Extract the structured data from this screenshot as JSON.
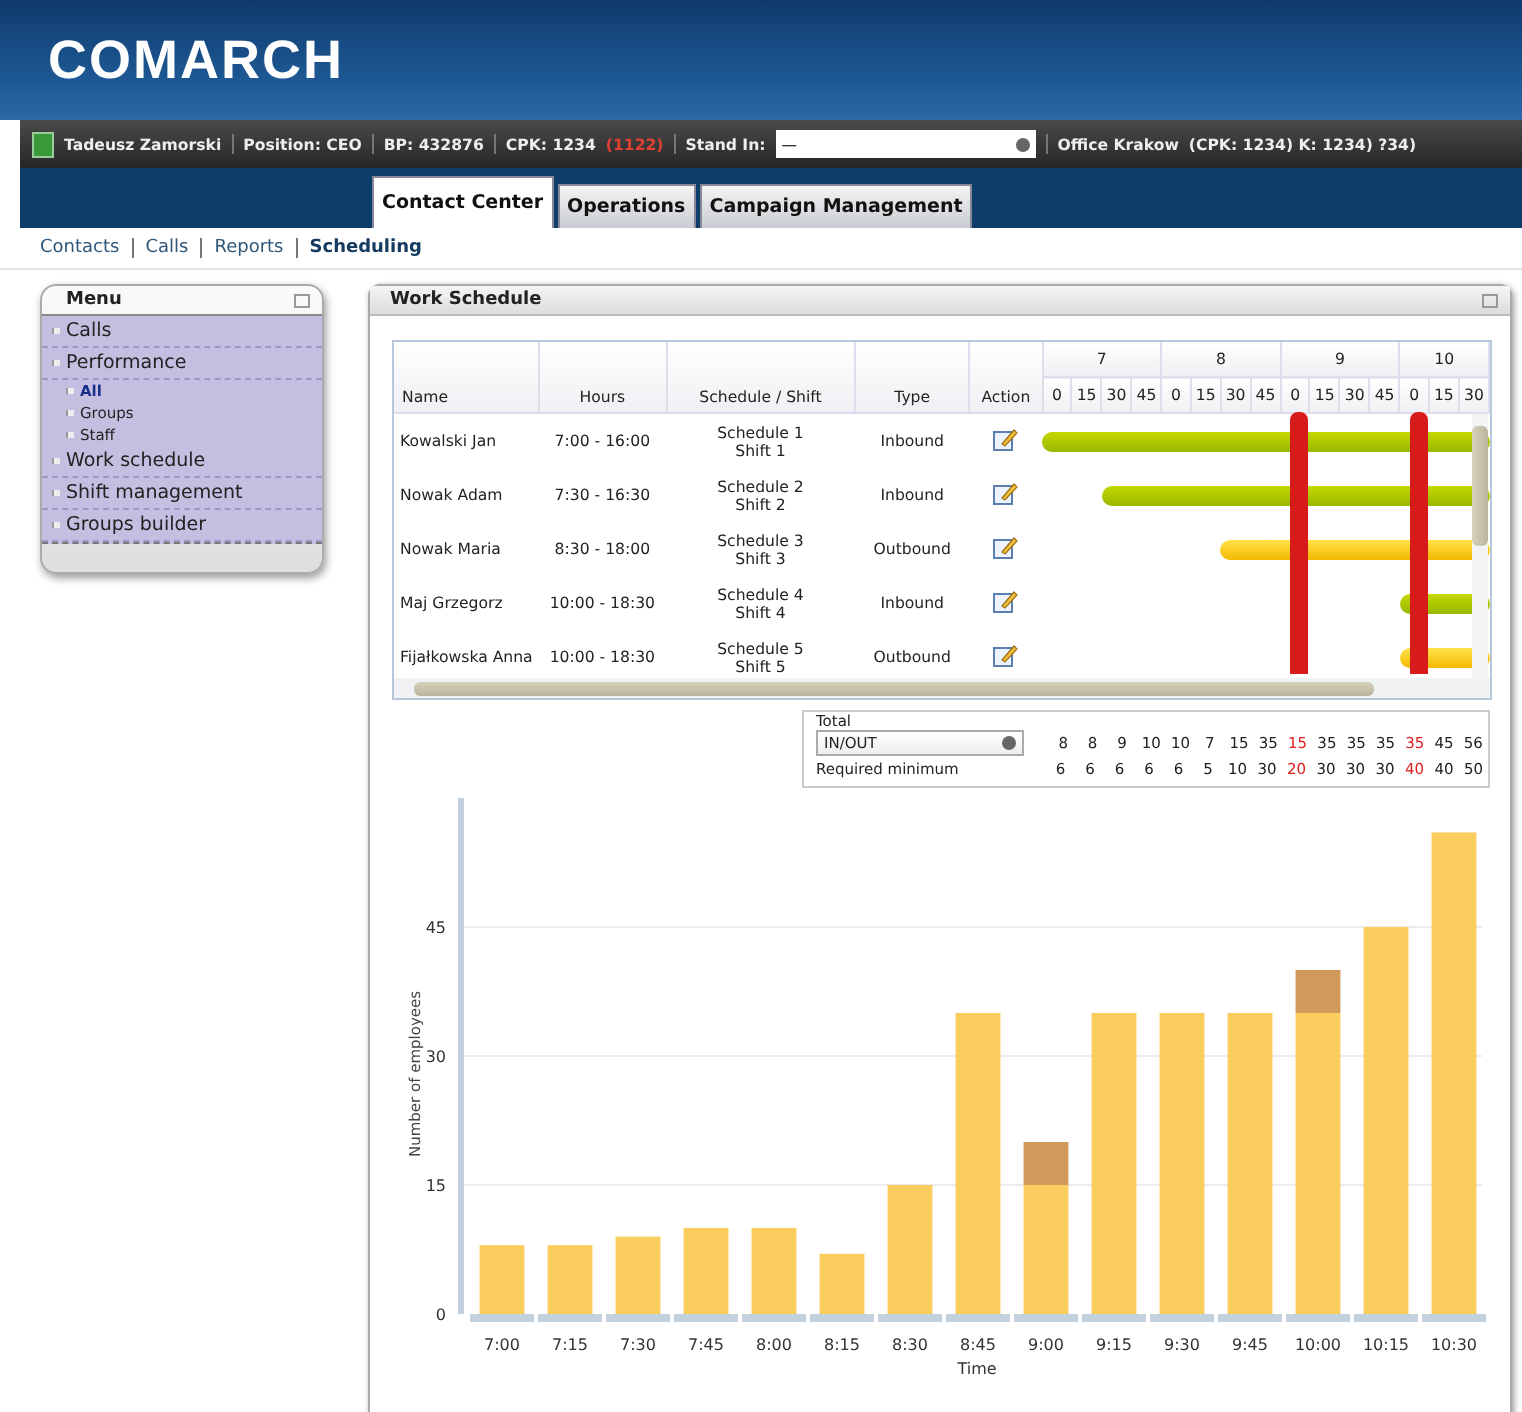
{
  "logo": "COMARCH",
  "user_bar": {
    "user": "Tadeusz Zamorski",
    "position": "Position: CEO",
    "bp": "BP: 432876",
    "cpk": "CPK: 1234",
    "cpk_alert": "(1122)",
    "stand_in_label": "Stand In:",
    "stand_in_value": "—",
    "office": "Office Krakow",
    "office_codes": "(CPK: 1234) K: 1234) ?34)"
  },
  "tabs": [
    {
      "label": "Contact Center",
      "selected": true
    },
    {
      "label": "Operations",
      "selected": false
    },
    {
      "label": "Campaign Management",
      "selected": false
    }
  ],
  "subnav": [
    {
      "label": "Contacts",
      "selected": false
    },
    {
      "label": "Calls",
      "selected": false
    },
    {
      "label": "Reports",
      "selected": false
    },
    {
      "label": "Scheduling",
      "selected": true
    }
  ],
  "menu": {
    "title": "Menu",
    "items": [
      {
        "label": "Calls",
        "selected": false
      },
      {
        "label": "Performance",
        "selected": false,
        "children": [
          {
            "label": "All",
            "selected": true
          },
          {
            "label": "Groups",
            "selected": false
          },
          {
            "label": "Staff",
            "selected": false
          }
        ]
      },
      {
        "label": "Work schedule",
        "selected": false
      },
      {
        "label": "Shift management",
        "selected": false
      },
      {
        "label": "Groups builder",
        "selected": false
      }
    ]
  },
  "panel_title": "Work Schedule",
  "schedule": {
    "columns": [
      "Name",
      "Hours",
      "Schedule / Shift",
      "Type",
      "Action"
    ],
    "hours": [
      {
        "label": "7",
        "alert": false,
        "slots": [
          "0",
          "15",
          "30",
          "45"
        ]
      },
      {
        "label": "8",
        "alert": false,
        "slots": [
          "0",
          "15",
          "30",
          "45"
        ]
      },
      {
        "label": "9",
        "alert": true,
        "slots": [
          "0",
          "15",
          "30",
          "45"
        ]
      },
      {
        "label": "10",
        "alert": true,
        "slots": [
          "0",
          "15",
          "30"
        ]
      }
    ],
    "rows": [
      {
        "name": "Kowalski Jan",
        "hours": "7:00 - 16:00",
        "schedule": "Schedule 1",
        "shift": "Shift 1",
        "type": "Inbound",
        "kind": "inbound",
        "level": 1.0
      },
      {
        "name": "Nowak Adam",
        "hours": "7:30 - 16:30",
        "schedule": "Schedule 2",
        "shift": "Shift 2",
        "type": "Inbound",
        "kind": "inbound",
        "level": 0.867
      },
      {
        "name": "Nowak Maria",
        "hours": "8:30 - 18:00",
        "schedule": "Schedule 3",
        "shift": "Shift 3",
        "type": "Outbound",
        "kind": "outbound",
        "level": 0.6
      },
      {
        "name": "Maj Grzegorz",
        "hours": "10:00 - 18:30",
        "schedule": "Schedule 4",
        "shift": "Shift 4",
        "type": "Inbound",
        "kind": "inbound",
        "level": 0.2
      },
      {
        "name": "Fijałkowska Anna",
        "hours": "10:00 - 18:30",
        "schedule": "Schedule 5",
        "shift": "Shift 5",
        "type": "Outbound",
        "kind": "outbound",
        "level": 0.2
      }
    ]
  },
  "totals": {
    "title": "Total",
    "select": "IN/OUT",
    "total_cells": [
      {
        "value": "8",
        "alert": false
      },
      {
        "value": "8",
        "alert": false
      },
      {
        "value": "9",
        "alert": false
      },
      {
        "value": "10",
        "alert": false
      },
      {
        "value": "10",
        "alert": false
      },
      {
        "value": "7",
        "alert": false
      },
      {
        "value": "15",
        "alert": false
      },
      {
        "value": "35",
        "alert": false
      },
      {
        "value": "15",
        "alert": true
      },
      {
        "value": "35",
        "alert": false
      },
      {
        "value": "35",
        "alert": false
      },
      {
        "value": "35",
        "alert": false
      },
      {
        "value": "35",
        "alert": true
      },
      {
        "value": "45",
        "alert": false
      },
      {
        "value": "56",
        "alert": false
      }
    ],
    "required_label": "Required minimum",
    "required_cells": [
      {
        "value": "6",
        "alert": false
      },
      {
        "value": "6",
        "alert": false
      },
      {
        "value": "6",
        "alert": false
      },
      {
        "value": "6",
        "alert": false
      },
      {
        "value": "6",
        "alert": false
      },
      {
        "value": "5",
        "alert": false
      },
      {
        "value": "10",
        "alert": false
      },
      {
        "value": "30",
        "alert": false
      },
      {
        "value": "20",
        "alert": true
      },
      {
        "value": "30",
        "alert": false
      },
      {
        "value": "30",
        "alert": false
      },
      {
        "value": "30",
        "alert": false
      },
      {
        "value": "40",
        "alert": true
      },
      {
        "value": "40",
        "alert": false
      },
      {
        "value": "50",
        "alert": false
      }
    ]
  },
  "chart_data": {
    "type": "bar",
    "stacked": true,
    "xlabel": "Time",
    "ylabel": "Number of employees",
    "categories": [
      "7:00",
      "7:15",
      "7:30",
      "7:45",
      "8:00",
      "8:15",
      "8:30",
      "8:45",
      "9:00",
      "9:15",
      "9:30",
      "9:45",
      "10:00",
      "10:15",
      "10:30"
    ],
    "ylim": [
      0,
      60
    ],
    "yticks": [
      0,
      15,
      30,
      45
    ],
    "grid": true,
    "series": [
      {
        "color": "#fbcd5e",
        "values": [
          8,
          8,
          9,
          10,
          10,
          7,
          15,
          35,
          15,
          35,
          35,
          35,
          35,
          45,
          56
        ]
      },
      {
        "color": "#d29a5a",
        "values": [
          0,
          0,
          0,
          0,
          0,
          0,
          0,
          0,
          5,
          0,
          0,
          0,
          5,
          0,
          0
        ]
      }
    ]
  }
}
